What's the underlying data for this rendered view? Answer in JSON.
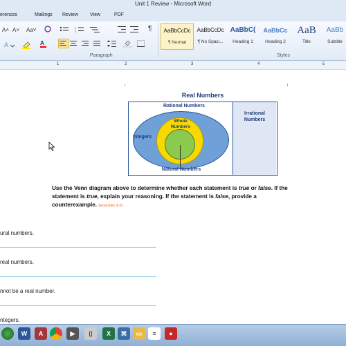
{
  "window": {
    "title": "Unit 1 Review - Microsoft Word"
  },
  "tabs": [
    "erences",
    "Mailings",
    "Review",
    "View",
    "PDF"
  ],
  "ribbon": {
    "groups": {
      "paragraph": "Paragraph",
      "styles": "Styles"
    },
    "font_buttons": {
      "grow": "A˄",
      "shrink": "A˅",
      "change_case": "Aa˅",
      "font_color": "A"
    },
    "pilcrow": "¶",
    "styles": [
      {
        "preview": "AaBbCcDc",
        "name": "¶ Normal",
        "selected": true
      },
      {
        "preview": "AaBbCcDc",
        "name": "¶ No Spaci...",
        "selected": false
      },
      {
        "preview": "AaBbC(",
        "name": "Heading 1",
        "selected": false
      },
      {
        "preview": "AaBbCc",
        "name": "Heading 2",
        "selected": false
      },
      {
        "preview": "AaB",
        "name": "Title",
        "selected": false
      },
      {
        "preview": "AaBb",
        "name": "Subtitle",
        "selected": false
      }
    ]
  },
  "ruler": {
    "numbers": [
      "1",
      "2",
      "3",
      "4",
      "5"
    ]
  },
  "document": {
    "venn": {
      "title": "Real Numbers",
      "rational": "Rational Numbers",
      "irrational_line1": "Irrational",
      "irrational_line2": "Numbers",
      "integers": "Integers",
      "whole_line1": "Whole",
      "whole_line2": "Numbers",
      "natural": "Natural Numbers"
    },
    "prompt": {
      "p1": "Use the Venn diagram above to determine whether each statement is ",
      "true1": "true",
      "p2": " or ",
      "false1": "false",
      "p3": ". If the statement is ",
      "true2": "true",
      "p4": ", explain your reasoning. If the statement is ",
      "false2": "false",
      "p5": ", provide a counterexample.",
      "ref": "(Examples 3–5)"
    },
    "items": [
      {
        "text": "ural numbers."
      },
      {
        "text": "real numbers."
      },
      {
        "text": "nnot be a real number."
      },
      {
        "text": "ntegers."
      }
    ]
  },
  "taskbar": {
    "icons": [
      "windows-orb-icon",
      "word-icon",
      "access-icon",
      "chrome-icon",
      "media-player-icon",
      "tablet-icon",
      "excel-icon",
      "network-icon",
      "explorer-icon",
      "notepad-icon",
      "recording-icon"
    ]
  }
}
